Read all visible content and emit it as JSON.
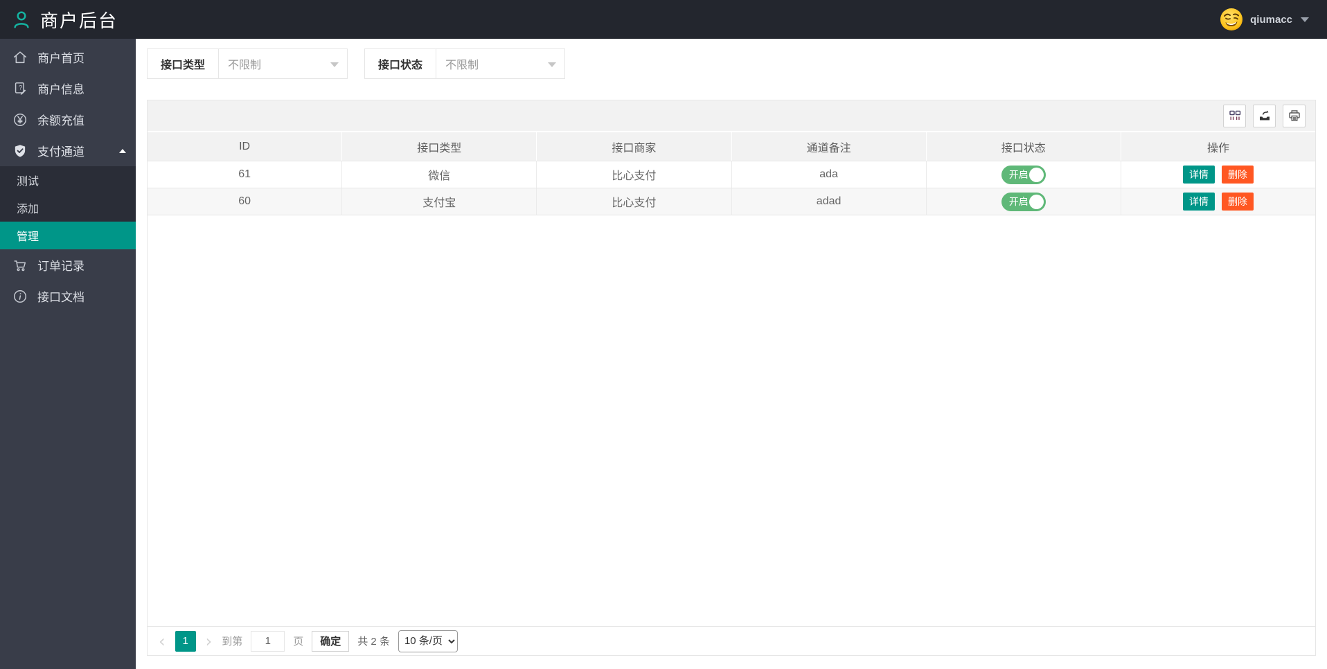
{
  "header": {
    "title": "商户后台",
    "username": "qiumacc"
  },
  "sidebar": {
    "items": [
      {
        "label": "商户首页",
        "icon": "home-icon"
      },
      {
        "label": "商户信息",
        "icon": "merchant-info-icon"
      },
      {
        "label": "余额充值",
        "icon": "yen-recharge-icon"
      },
      {
        "label": "支付通道",
        "icon": "shield-check-icon",
        "expanded": true
      },
      {
        "label": "订单记录",
        "icon": "cart-icon"
      },
      {
        "label": "接口文档",
        "icon": "info-icon"
      }
    ],
    "submenu": [
      {
        "label": "测试",
        "active": false
      },
      {
        "label": "添加",
        "active": false
      },
      {
        "label": "管理",
        "active": true
      }
    ]
  },
  "filters": {
    "type_label": "接口类型",
    "type_value": "不限制",
    "status_label": "接口状态",
    "status_value": "不限制"
  },
  "toolbar": {
    "icons": [
      "columns-icon",
      "export-icon",
      "print-icon"
    ]
  },
  "table": {
    "columns": [
      "ID",
      "接口类型",
      "接口商家",
      "通道备注",
      "接口状态",
      "操作"
    ],
    "rows": [
      {
        "id": "61",
        "type": "微信",
        "merchant": "比心支付",
        "remark": "ada",
        "status_label": "开启",
        "status_on": true
      },
      {
        "id": "60",
        "type": "支付宝",
        "merchant": "比心支付",
        "remark": "adad",
        "status_label": "开启",
        "status_on": true
      }
    ],
    "action_detail": "详情",
    "action_delete": "删除"
  },
  "pagination": {
    "current_page": "1",
    "goto_label": "到第",
    "goto_value": "1",
    "page_unit": "页",
    "confirm_label": "确定",
    "total_label": "共 2 条",
    "page_size_option": "10 条/页"
  },
  "colors": {
    "accent": "#009688",
    "toggle_on": "#5FB878",
    "danger": "#FF5722",
    "topbar_bg": "#23262E",
    "sidebar_bg": "#393D49",
    "submenu_bg": "#2A2D37",
    "table_header_bg": "#f2f2f2"
  }
}
